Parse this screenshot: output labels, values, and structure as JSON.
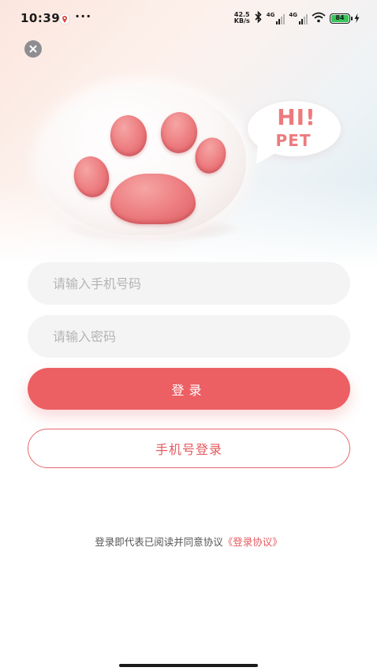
{
  "status_bar": {
    "time": "10:39",
    "more": "···",
    "net_speed_value": "42.5",
    "net_speed_unit": "KB/s",
    "signal_1_label": "4G",
    "signal_2_label": "4G",
    "battery_level": "84"
  },
  "hero": {
    "bubble_line1": "HI!",
    "bubble_line2": "PET"
  },
  "form": {
    "phone_placeholder": "请输入手机号码",
    "phone_value": "",
    "password_placeholder": "请输入密码",
    "password_value": "",
    "login_label": "登录",
    "phone_login_label": "手机号登录"
  },
  "agreement": {
    "text": "登录即代表已阅读并同意协议",
    "link": "《登录协议》"
  },
  "icons": [
    "close-icon",
    "notification-icon",
    "bluetooth-icon",
    "signal-icon",
    "wifi-icon",
    "battery-icon",
    "charging-icon"
  ],
  "colors": {
    "accent": "#ec5f63",
    "accent_text": "#e45a5f",
    "input_bg": "#f4f4f4",
    "placeholder": "#b4b4b4",
    "paw_pink": "#ec7b7e"
  }
}
